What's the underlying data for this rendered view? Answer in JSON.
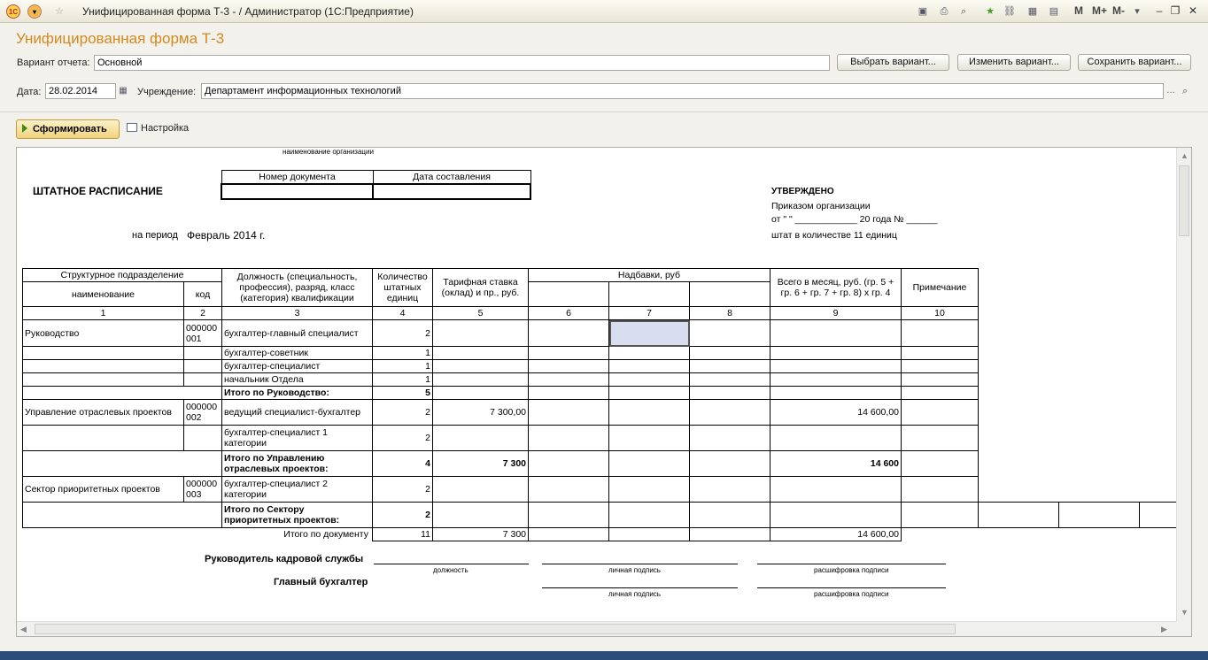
{
  "titlebar": {
    "logo": "1С",
    "title": "Унифицированная форма Т-3 - / Администратор  (1С:Предприятие)",
    "m_labels": [
      "M",
      "M+",
      "M-"
    ]
  },
  "form": {
    "title": "Унифицированная форма Т-3",
    "variant_label": "Вариант отчета:",
    "variant_value": "Основной",
    "choose_variant": "Выбрать вариант...",
    "change_variant": "Изменить вариант...",
    "save_variant": "Сохранить вариант...",
    "date_label": "Дата:",
    "date_value": "28.02.2014",
    "org_label": "Учреждение:",
    "org_value": "Департамент информационных технологий",
    "generate": "Сформировать",
    "settings": "Настройка"
  },
  "report": {
    "org_caption": "наименование организации",
    "title": "ШТАТНОЕ РАСПИСАНИЕ",
    "doc_number_header": "Номер документа",
    "doc_date_header": "Дата составления",
    "period_label": "на период",
    "period_value": "Февраль 2014 г.",
    "approved": "УТВЕРЖДЕНО",
    "order_line": "Приказом организации",
    "order_date_line": "от \"     \" ____________ 20      года № ______",
    "staff_line": "штат в количестве 11 единиц",
    "headers": {
      "struct": "Структурное  подразделение",
      "name": "наименование",
      "code": "код",
      "position": "Должность (специальность, профессия), разряд, класс (категория) квалификации",
      "count": "Количество штатных единиц",
      "rate": "Тарифная ставка (оклад) и пр., руб.",
      "allowances": "Надбавки, руб",
      "total": "Всего в месяц, руб. (гр. 5 + гр. 6 + гр. 7 + гр. 8) х гр. 4",
      "note": "Примечание"
    },
    "col_numbers": [
      "1",
      "2",
      "3",
      "4",
      "5",
      "6",
      "7",
      "8",
      "9",
      "10"
    ],
    "rows": [
      {
        "name": "Руководство",
        "code": "000000 001",
        "position": "бухгалтер-главный специалист",
        "count": "2",
        "rate": "",
        "total": ""
      },
      {
        "name": "",
        "code": "",
        "position": "бухгалтер-советник",
        "count": "1",
        "rate": "",
        "total": ""
      },
      {
        "name": "",
        "code": "",
        "position": "бухгалтер-специалист",
        "count": "1",
        "rate": "",
        "total": ""
      },
      {
        "name": "",
        "code": "",
        "position": "начальник Отдела",
        "count": "1",
        "rate": "",
        "total": ""
      },
      {
        "subtotal": "Итого по Руководство:",
        "count": "5",
        "rate": "",
        "total": ""
      },
      {
        "name": "Управление отраслевых проектов",
        "code": "000000 002",
        "position": "ведущий специалист-бухгалтер",
        "count": "2",
        "rate": "7 300,00",
        "total": "14 600,00"
      },
      {
        "name": "",
        "code": "",
        "position": "бухгалтер-специалист 1 категории",
        "count": "2",
        "rate": "",
        "total": ""
      },
      {
        "subtotal": "Итого по Управлению отраслевых проектов:",
        "count": "4",
        "rate": "7 300",
        "total": "14 600"
      },
      {
        "name": "Сектор приоритетных проектов",
        "code": "000000 003",
        "position": "бухгалтер-специалист 2 категории",
        "count": "2",
        "rate": "",
        "total": ""
      },
      {
        "subtotal": "Итого по Сектору приоритетных проектов:",
        "count": "2",
        "rate": "",
        "total": ""
      }
    ],
    "doc_total": {
      "label": "Итого по документу",
      "count": "11",
      "rate": "7 300",
      "total": "14 600,00"
    },
    "signatures": {
      "hr_head": "Руководитель кадровой службы",
      "chief_accountant": "Главный бухгалтер",
      "position_caption": "должность",
      "signature_caption": "личная подпись",
      "decoding_caption": "расшифровка подписи"
    }
  }
}
